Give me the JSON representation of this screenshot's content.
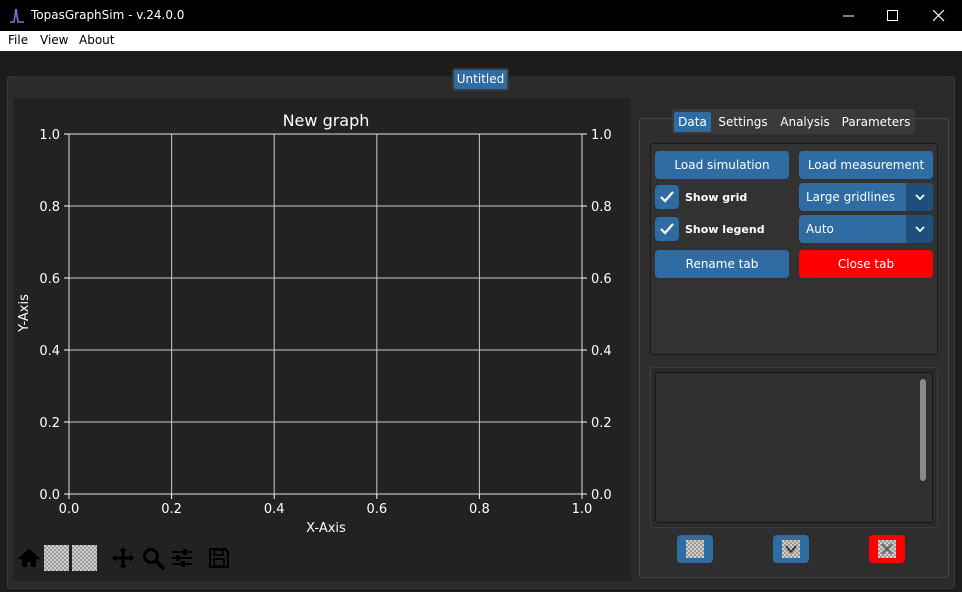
{
  "window": {
    "title": "TopasGraphSim - v.24.0.0"
  },
  "menu": {
    "items": [
      "File",
      "View",
      "About"
    ]
  },
  "document_tab": {
    "label": "Untitled"
  },
  "plot": {
    "title": "New graph",
    "xlabel": "X-Axis",
    "ylabel": "Y-Axis",
    "x_ticks": [
      "0.0",
      "0.2",
      "0.4",
      "0.6",
      "0.8",
      "1.0"
    ],
    "y_ticks": [
      "0.0",
      "0.2",
      "0.4",
      "0.6",
      "0.8",
      "1.0"
    ],
    "xlim": [
      0,
      1
    ],
    "ylim": [
      0,
      1
    ],
    "grid": true,
    "colors": {
      "background": "#222222",
      "grid": "#c8c8c8",
      "text": "#ffffff"
    }
  },
  "toolbar": {
    "icons": [
      "home-icon",
      "back-icon",
      "forward-icon",
      "pan-icon",
      "zoom-icon",
      "configure-icon",
      "save-icon"
    ]
  },
  "right_panel": {
    "tabs": [
      "Data",
      "Settings",
      "Analysis",
      "Parameters"
    ],
    "active_tab": "Data",
    "load_simulation": "Load simulation",
    "load_measurement": "Load measurement",
    "show_grid_label": "Show grid",
    "show_grid_checked": true,
    "show_legend_label": "Show legend",
    "show_legend_checked": true,
    "gridlines_value": "Large gridlines",
    "legend_position_value": "Auto",
    "rename_tab": "Rename tab",
    "close_tab": "Close tab"
  },
  "colors": {
    "accent": "#2f6ca3",
    "danger": "#ff0000"
  }
}
